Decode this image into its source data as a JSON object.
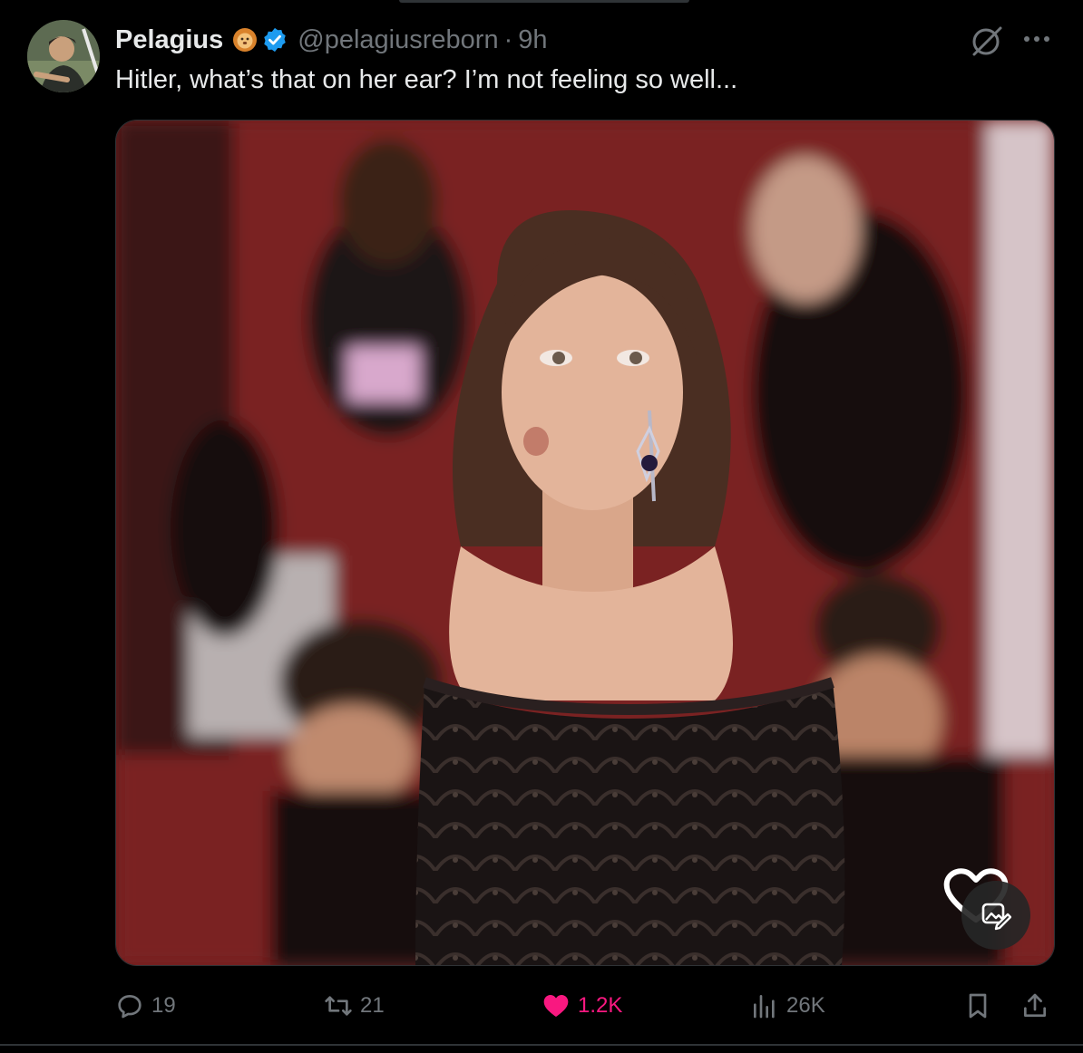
{
  "tweet": {
    "display_name": "Pelagius",
    "handle": "@pelagiusreborn",
    "separator": "·",
    "time": "9h",
    "text": "Hitler, what’s that on her ear? I’m not feeling so well...",
    "badges": [
      "lion-emoji-icon",
      "verified-badge-icon"
    ],
    "media": {
      "subject": "photo",
      "overlay_icons": [
        "heart-icon",
        "edit-image-icon"
      ]
    }
  },
  "actions": {
    "replies": "19",
    "retweets": "21",
    "likes": "1.2K",
    "views": "26K",
    "like_color": "#f91880"
  },
  "colors": {
    "background": "#000000",
    "primary_text": "#e7e9ea",
    "secondary_text": "#71767b",
    "verified_blue": "#1d9bf0"
  }
}
